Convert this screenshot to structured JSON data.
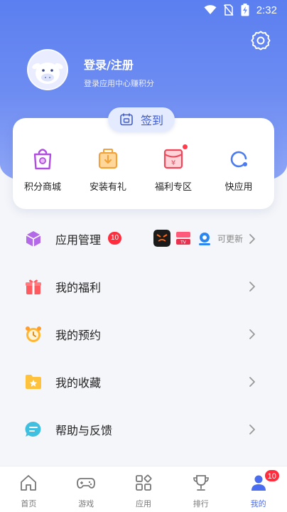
{
  "status_bar": {
    "time": "2:32",
    "icons": [
      "wifi-icon",
      "no-sim-icon",
      "battery-charging-icon"
    ]
  },
  "profile": {
    "login_label": "登录/注册",
    "login_subtitle": "登录应用中心赚积分"
  },
  "checkin": {
    "label": "签到"
  },
  "quick_links": [
    {
      "label": "积分商城",
      "icon": "shopping-bag-icon",
      "color": "#b04de0"
    },
    {
      "label": "安装有礼",
      "icon": "gift-box-download-icon",
      "color": "#f2a23a"
    },
    {
      "label": "福利专区",
      "icon": "red-envelope-icon",
      "color": "#f0485a",
      "has_dot": true
    },
    {
      "label": "快应用",
      "icon": "quick-app-icon",
      "color": "#4a7bf0"
    }
  ],
  "menu": [
    {
      "label": "应用管理",
      "icon": "cube-icon",
      "badge": "10",
      "update_text": "可更新"
    },
    {
      "label": "我的福利",
      "icon": "gift-icon"
    },
    {
      "label": "我的预约",
      "icon": "alarm-clock-icon"
    },
    {
      "label": "我的收藏",
      "icon": "star-folder-icon"
    },
    {
      "label": "帮助与反馈",
      "icon": "chat-bubble-icon"
    }
  ],
  "tabs": [
    {
      "label": "首页",
      "icon": "home-icon"
    },
    {
      "label": "游戏",
      "icon": "gamepad-icon"
    },
    {
      "label": "应用",
      "icon": "apps-grid-icon"
    },
    {
      "label": "排行",
      "icon": "trophy-icon"
    },
    {
      "label": "我的",
      "icon": "person-icon",
      "active": true,
      "badge": "10"
    }
  ],
  "colors": {
    "header": "#5b7ff0",
    "accent": "#4a6cf0",
    "badge": "#ff2d3d"
  }
}
